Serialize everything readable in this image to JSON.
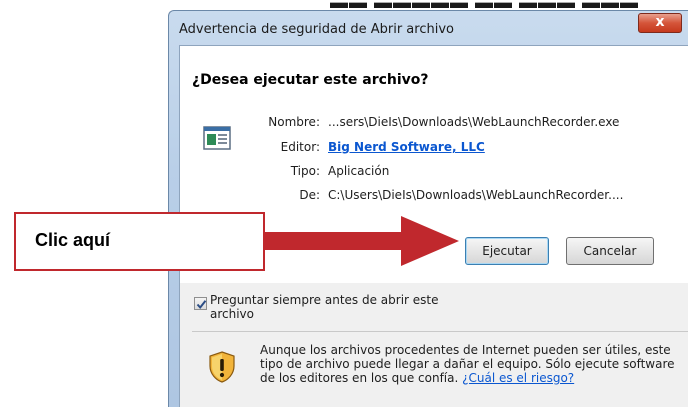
{
  "window": {
    "title": "Advertencia de seguridad de Abrir archivo",
    "close_glyph": "x"
  },
  "dialog": {
    "question": "¿Desea ejecutar este archivo?",
    "fields": [
      {
        "label": "Nombre:",
        "value": "...sers\\DieIs\\Downloads\\WebLaunchRecorder.exe"
      },
      {
        "label": "Editor:",
        "value": "Big Nerd Software, LLC"
      },
      {
        "label": "Tipo:",
        "value": "Aplicación"
      },
      {
        "label": "De:",
        "value": "C:\\Users\\DieIs\\Downloads\\WebLaunchRecorder...."
      }
    ],
    "buttons": {
      "run": "Ejecutar",
      "cancel": "Cancelar"
    },
    "checkbox": {
      "label": "Preguntar siempre antes de abrir este archivo",
      "checked": true
    },
    "warning": {
      "text": "Aunque los archivos procedentes de Internet pueden ser útiles, este tipo de archivo puede llegar a dañar el equipo. Sólo ejecute software de los editores en los que confía. ",
      "link": "¿Cuál es el riesgo?"
    }
  },
  "callout": {
    "text": "Clic aquí",
    "accent": "#c0282d"
  },
  "icons": {
    "file": "application-file-icon",
    "shield": "security-shield-icon",
    "check": "checkmark-icon"
  }
}
